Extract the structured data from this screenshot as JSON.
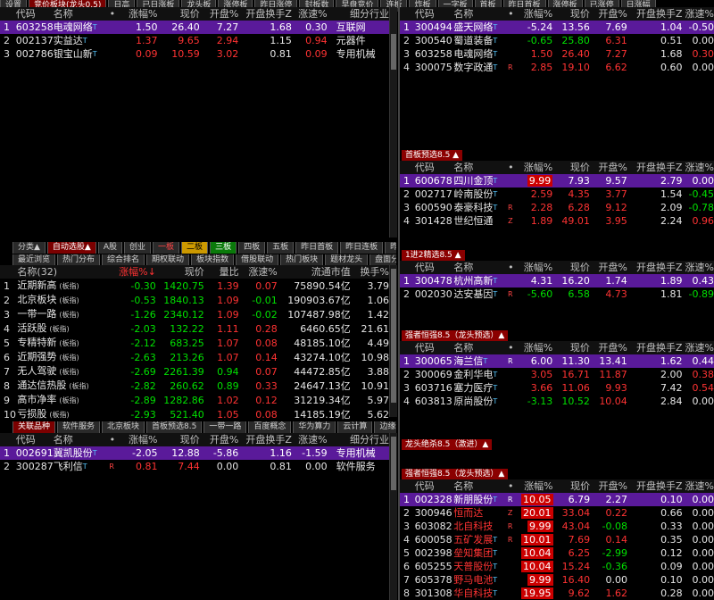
{
  "top_tabs": [
    "设置",
    "竞价板块(龙头0.5)",
    "日高",
    "已日涨板",
    "龙头板",
    "涨停板",
    "昨日涨停",
    "封板数",
    "早盘竞价",
    "连板",
    "炸板",
    "一字板",
    "首板",
    "昨日首板",
    "涨停板",
    "已涨停",
    "日涨幅"
  ],
  "panel1": {
    "headers": [
      "代码",
      "名称",
      "•",
      "涨幅%",
      "现价",
      "开盘%",
      "开盘换手Z",
      "涨速%",
      "细分行业"
    ],
    "rows": [
      {
        "n": "1",
        "code": "603258",
        "name": "电魂网络",
        "tag": "T",
        "chg": "1.50",
        "price": "26.40",
        "open": "7.27",
        "turn": "1.68",
        "spd": "0.30",
        "ind": "互联网",
        "sel": true
      },
      {
        "n": "2",
        "code": "002137",
        "name": "实益达",
        "tag": "T",
        "chg": "1.37",
        "price": "9.65",
        "open": "2.94",
        "turn": "1.15",
        "spd": "0.94",
        "ind": "元器件"
      },
      {
        "n": "3",
        "code": "002786",
        "name": "银宝山新",
        "tag": "T",
        "chg": "0.09",
        "price": "10.59",
        "open": "3.02",
        "turn": "0.81",
        "spd": "0.09",
        "ind": "专用机械"
      }
    ]
  },
  "panel2": {
    "headers": [
      "代码",
      "名称",
      "•",
      "涨幅%",
      "现价",
      "开盘%",
      "开盘换手Z",
      "涨速%"
    ],
    "rows": [
      {
        "n": "1",
        "code": "300494",
        "name": "盛天网络",
        "tag": "T",
        "chg": "-5.24",
        "price": "13.56",
        "open": "7.69",
        "turn": "1.04",
        "spd": "-0.50",
        "sel": true
      },
      {
        "n": "2",
        "code": "300540",
        "name": "蜀道装备",
        "tag": "T",
        "chg": "-0.65",
        "price": "25.80",
        "open": "6.31",
        "turn": "0.51",
        "spd": "0.00"
      },
      {
        "n": "3",
        "code": "603258",
        "name": "电魂网络",
        "tag": "T",
        "chg": "1.50",
        "price": "26.40",
        "open": "7.27",
        "turn": "1.68",
        "spd": "0.30"
      },
      {
        "n": "4",
        "code": "300075",
        "name": "数字政通",
        "tag": "T",
        "mark": "R",
        "chg": "2.85",
        "price": "19.10",
        "open": "6.62",
        "turn": "0.60",
        "spd": "0.00"
      }
    ]
  },
  "sec_shouban": {
    "title": "首板预选8.5 ▲",
    "headers": [
      "代码",
      "名称",
      "•",
      "涨幅%",
      "现价",
      "开盘%",
      "开盘换手Z",
      "涨速%"
    ],
    "rows": [
      {
        "n": "1",
        "code": "600678",
        "name": "四川金顶",
        "tag": "T",
        "chg": "9.99",
        "price": "7.93",
        "open": "9.57",
        "turn": "2.79",
        "spd": "0.00",
        "sel": true,
        "badge": true
      },
      {
        "n": "2",
        "code": "002717",
        "name": "岭南股份",
        "tag": "T",
        "chg": "2.59",
        "price": "4.35",
        "open": "3.77",
        "turn": "1.54",
        "spd": "-0.45"
      },
      {
        "n": "3",
        "code": "600590",
        "name": "泰豪科技",
        "tag": "T",
        "mark": "R",
        "chg": "2.28",
        "price": "6.28",
        "open": "9.12",
        "turn": "2.09",
        "spd": "-0.78"
      },
      {
        "n": "4",
        "code": "301428",
        "name": "世纪恒通",
        "tag": "",
        "mark": "Z",
        "chg": "1.89",
        "price": "49.01",
        "open": "3.95",
        "turn": "2.24",
        "spd": "0.96"
      }
    ]
  },
  "sec_yijin": {
    "title": "1进2精选8.5 ▲",
    "headers": [
      "代码",
      "名称",
      "•",
      "涨幅%",
      "现价",
      "开盘%",
      "开盘换手Z",
      "涨速%"
    ],
    "rows": [
      {
        "n": "1",
        "code": "300478",
        "name": "杭州高新",
        "tag": "T",
        "chg": "4.31",
        "price": "16.20",
        "open": "1.74",
        "turn": "1.89",
        "spd": "0.43",
        "sel": true
      },
      {
        "n": "2",
        "code": "002030",
        "name": "达安基因",
        "tag": "T",
        "mark": "R",
        "chg": "-5.60",
        "price": "6.58",
        "open": "4.73",
        "turn": "1.81",
        "spd": "-0.89"
      }
    ]
  },
  "sec_qiangzhe": {
    "title": "强者恒强8.5（龙头预选）▲",
    "headers": [
      "代码",
      "名称",
      "•",
      "涨幅%",
      "现价",
      "开盘%",
      "开盘换手Z",
      "涨速%"
    ],
    "rows": [
      {
        "n": "1",
        "code": "300065",
        "name": "海兰信",
        "tag": "T",
        "mark": "R",
        "chg": "6.00",
        "price": "11.30",
        "open": "13.41",
        "turn": "1.62",
        "spd": "0.44",
        "sel": true
      },
      {
        "n": "2",
        "code": "300069",
        "name": "金利华电",
        "tag": "T",
        "chg": "3.05",
        "price": "16.71",
        "open": "11.87",
        "turn": "2.00",
        "spd": "0.38"
      },
      {
        "n": "3",
        "code": "603716",
        "name": "塞力医疗",
        "tag": "T",
        "chg": "3.66",
        "price": "11.06",
        "open": "9.93",
        "turn": "7.42",
        "spd": "0.54"
      },
      {
        "n": "4",
        "code": "603813",
        "name": "原尚股份",
        "tag": "T",
        "chg": "-3.13",
        "price": "10.52",
        "open": "10.04",
        "turn": "2.84",
        "spd": "0.00"
      }
    ]
  },
  "sec_longtou": {
    "title": "龙头绝杀8.5（激进）▲"
  },
  "sec_qiangzhe2": {
    "title": "强者恒强8.5（龙头预选）▲",
    "headers": [
      "代码",
      "名称",
      "•",
      "涨幅%",
      "现价",
      "开盘%",
      "开盘换手Z",
      "涨速%"
    ],
    "rows": [
      {
        "n": "1",
        "code": "002328",
        "name": "新朋股份",
        "tag": "T",
        "mark": "R",
        "chg": "10.05",
        "price": "6.79",
        "open": "2.27",
        "turn": "0.10",
        "spd": "0.00",
        "sel": true,
        "badge": true
      },
      {
        "n": "2",
        "code": "300946",
        "name": "恒而达",
        "tag": "",
        "mark": "Z",
        "chg": "20.01",
        "price": "33.04",
        "open": "0.22",
        "turn": "0.66",
        "spd": "0.00",
        "badge": true
      },
      {
        "n": "3",
        "code": "603082",
        "name": "北自科技",
        "tag": "",
        "mark": "R",
        "chg": "9.99",
        "price": "43.04",
        "open": "-0.08",
        "turn": "0.33",
        "spd": "0.00",
        "badge": true
      },
      {
        "n": "4",
        "code": "600058",
        "name": "五矿发展",
        "tag": "T",
        "mark": "R",
        "chg": "10.01",
        "price": "7.69",
        "open": "0.14",
        "turn": "0.35",
        "spd": "0.00",
        "badge": true
      },
      {
        "n": "5",
        "code": "002398",
        "name": "垒知集团",
        "tag": "T",
        "chg": "10.04",
        "price": "6.25",
        "open": "-2.99",
        "turn": "0.12",
        "spd": "0.00",
        "badge": true
      },
      {
        "n": "6",
        "code": "605255",
        "name": "天普股份",
        "tag": "T",
        "chg": "10.04",
        "price": "15.24",
        "open": "-0.36",
        "turn": "0.09",
        "spd": "0.00",
        "badge": true
      },
      {
        "n": "7",
        "code": "605378",
        "name": "野马电池",
        "tag": "T",
        "chg": "9.99",
        "price": "16.40",
        "open": "0.00",
        "turn": "0.10",
        "spd": "0.00",
        "badge": true
      },
      {
        "n": "8",
        "code": "301308",
        "name": "华自科技",
        "tag": "T",
        "chg": "19.95",
        "price": "9.62",
        "open": "1.62",
        "turn": "0.28",
        "spd": "0.00",
        "badge": true
      }
    ]
  },
  "mid_tabs_row1": [
    "分类▲",
    "自动选股▲",
    "A股",
    "创业",
    "一板",
    "二板",
    "三板",
    "四板",
    "五板",
    "昨日首板",
    "昨日连板",
    "昨曾涨停"
  ],
  "mid_tabs_row2": [
    "最近浏览",
    "热门分布",
    "综合排名",
    "期权联动",
    "板块指数",
    "借股联动",
    "热门板块",
    "题材龙头",
    "盘面分析"
  ],
  "index_panel": {
    "headers": [
      "名称(32)",
      "涨幅%↓",
      "现价",
      "量比",
      "涨速%",
      "流通市值",
      "换手%"
    ],
    "rows": [
      {
        "n": "1",
        "name": "近期新高",
        "tag": "(板指)",
        "chg": "-0.30",
        "price": "1420.75",
        "vr": "1.39",
        "spd": "0.07",
        "cap": "75890.54亿",
        "turn": "3.79"
      },
      {
        "n": "2",
        "name": "北京板块",
        "tag": "(板指)",
        "chg": "-0.53",
        "price": "1840.13",
        "vr": "1.09",
        "spd": "-0.01",
        "cap": "190903.67亿",
        "turn": "1.06"
      },
      {
        "n": "3",
        "name": "一带一路",
        "tag": "(板指)",
        "chg": "-1.26",
        "price": "2340.12",
        "vr": "1.09",
        "spd": "-0.02",
        "cap": "107487.98亿",
        "turn": "1.42"
      },
      {
        "n": "4",
        "name": "活跃股",
        "tag": "(板指)",
        "chg": "-2.03",
        "price": "132.22",
        "vr": "1.11",
        "spd": "0.28",
        "cap": "6460.65亿",
        "turn": "21.61"
      },
      {
        "n": "5",
        "name": "专精特新",
        "tag": "(板指)",
        "chg": "-2.12",
        "price": "683.25",
        "vr": "1.07",
        "spd": "0.08",
        "cap": "48185.10亿",
        "turn": "4.49"
      },
      {
        "n": "6",
        "name": "近期强势",
        "tag": "(板指)",
        "chg": "-2.63",
        "price": "213.26",
        "vr": "1.07",
        "spd": "0.14",
        "cap": "43274.10亿",
        "turn": "10.98"
      },
      {
        "n": "7",
        "name": "无人驾驶",
        "tag": "(板指)",
        "chg": "-2.69",
        "price": "2261.39",
        "vr": "0.94",
        "spd": "0.07",
        "cap": "44472.85亿",
        "turn": "3.88"
      },
      {
        "n": "8",
        "name": "通达信热股",
        "tag": "(板指)",
        "chg": "-2.82",
        "price": "260.62",
        "vr": "0.89",
        "spd": "0.33",
        "cap": "24647.13亿",
        "turn": "10.91"
      },
      {
        "n": "9",
        "name": "高市净率",
        "tag": "(板指)",
        "chg": "-2.89",
        "price": "1282.86",
        "vr": "1.02",
        "spd": "0.12",
        "cap": "31219.34亿",
        "turn": "5.97"
      },
      {
        "n": "10",
        "name": "亏损股",
        "tag": "(板指)",
        "chg": "-2.93",
        "price": "521.40",
        "vr": "1.05",
        "spd": "0.08",
        "cap": "14185.19亿",
        "turn": "5.62"
      }
    ]
  },
  "bottom_tabs": [
    "关联品种",
    "软件服务",
    "北京板块",
    "首板预选8.5",
    "一带一路",
    "百度概念",
    "华为算力",
    "云计算",
    "边缘计算"
  ],
  "panel_bottom": {
    "headers": [
      "代码",
      "名称",
      "•",
      "涨幅%",
      "现价",
      "开盘%",
      "开盘换手Z",
      "涨速%",
      "细分行业"
    ],
    "rows": [
      {
        "n": "1",
        "code": "002691",
        "name": "冀凯股份",
        "tag": "T",
        "chg": "-2.05",
        "price": "12.88",
        "open": "-5.86",
        "turn": "1.16",
        "spd": "-1.59",
        "ind": "专用机械",
        "sel": true
      },
      {
        "n": "2",
        "code": "300287",
        "name": "飞利信",
        "tag": "T",
        "mark": "R",
        "chg": "0.81",
        "price": "7.44",
        "open": "0.00",
        "turn": "0.81",
        "spd": "0.00",
        "ind": "软件服务"
      }
    ]
  }
}
